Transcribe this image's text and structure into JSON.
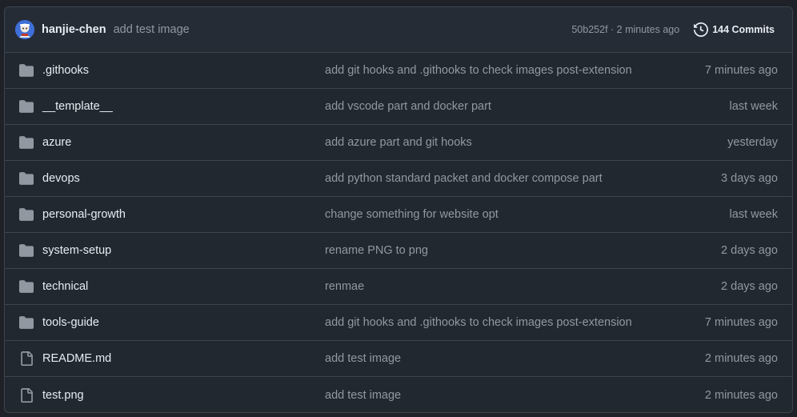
{
  "header": {
    "author": "hanjie-chen",
    "commit_message": "add test image",
    "commit_meta": "50b252f · 2 minutes ago",
    "commits_label": "144 Commits",
    "avatar_icon": "avatar-image",
    "history_icon": "history-icon"
  },
  "colors": {
    "background": "#212830",
    "header_background": "#262c36",
    "border": "#3d444d",
    "text_primary": "#e6edf3",
    "text_muted": "#9198a1",
    "folder_icon": "#9198a1"
  },
  "rows": [
    {
      "type": "folder",
      "icon": "folder-icon",
      "name": ".githooks",
      "message": "add git hooks and .githooks to check images post-extension",
      "age": "7 minutes ago"
    },
    {
      "type": "folder",
      "icon": "folder-icon",
      "name": "__template__",
      "message": "add vscode part and docker part",
      "age": "last week"
    },
    {
      "type": "folder",
      "icon": "folder-icon",
      "name": "azure",
      "message": "add azure part and git hooks",
      "age": "yesterday"
    },
    {
      "type": "folder",
      "icon": "folder-icon",
      "name": "devops",
      "message": "add python standard packet and docker compose part",
      "age": "3 days ago"
    },
    {
      "type": "folder",
      "icon": "folder-icon",
      "name": "personal-growth",
      "message": "change something for website opt",
      "age": "last week"
    },
    {
      "type": "folder",
      "icon": "folder-icon",
      "name": "system-setup",
      "message": "rename PNG to png",
      "age": "2 days ago"
    },
    {
      "type": "folder",
      "icon": "folder-icon",
      "name": "technical",
      "message": "renmae",
      "age": "2 days ago"
    },
    {
      "type": "folder",
      "icon": "folder-icon",
      "name": "tools-guide",
      "message": "add git hooks and .githooks to check images post-extension",
      "age": "7 minutes ago"
    },
    {
      "type": "file",
      "icon": "file-icon",
      "name": "README.md",
      "message": "add test image",
      "age": "2 minutes ago"
    },
    {
      "type": "file",
      "icon": "file-icon",
      "name": "test.png",
      "message": "add test image",
      "age": "2 minutes ago"
    }
  ]
}
